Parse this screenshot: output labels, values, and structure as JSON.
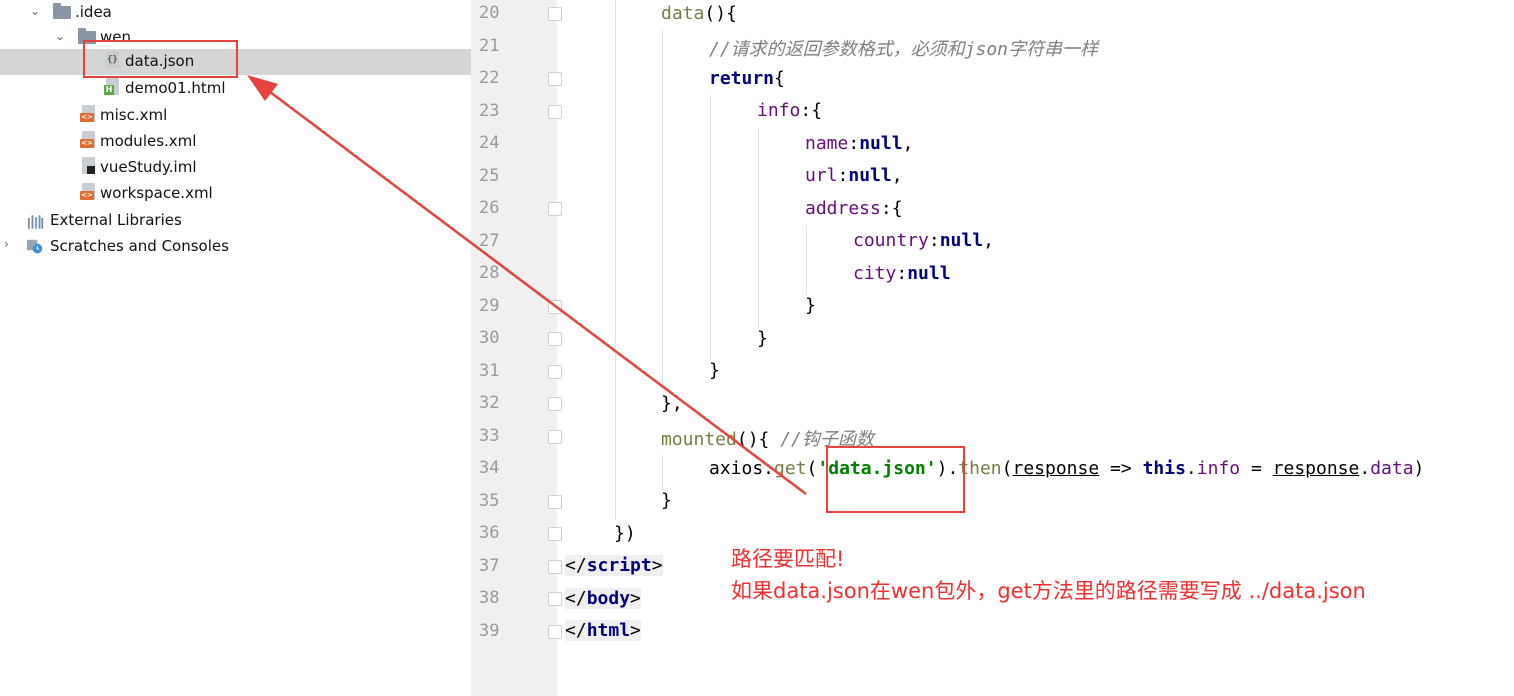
{
  "project_tree": {
    "items": [
      {
        "label": ".idea",
        "type": "folder",
        "expanded": true
      },
      {
        "label": "wen",
        "type": "folder",
        "expanded": true
      },
      {
        "label": "data.json",
        "type": "json",
        "selected": true
      },
      {
        "label": "demo01.html",
        "type": "html"
      },
      {
        "label": "misc.xml",
        "type": "xml"
      },
      {
        "label": "modules.xml",
        "type": "xml"
      },
      {
        "label": "vueStudy.iml",
        "type": "iml"
      },
      {
        "label": "workspace.xml",
        "type": "xml"
      },
      {
        "label": "External Libraries",
        "type": "libraries"
      },
      {
        "label": "Scratches and Consoles",
        "type": "scratches",
        "expanded": false
      }
    ]
  },
  "editor": {
    "line_numbers": [
      "20",
      "21",
      "22",
      "23",
      "24",
      "25",
      "26",
      "27",
      "28",
      "29",
      "30",
      "31",
      "32",
      "33",
      "34",
      "35",
      "36",
      "37",
      "38",
      "39"
    ],
    "lines": {
      "l20_fn": "data",
      "l20_rest": "(){",
      "l21_comment": "//请求的返回参数格式，必须和json字符串一样",
      "l22_kw": "return",
      "l22_rest": "{",
      "l23_prop": "info",
      "l23_rest": ":{",
      "l24_prop": "name",
      "l24_colon": ":",
      "l24_val": "null",
      "l24_rest": ",",
      "l25_prop": "url",
      "l25_colon": ":",
      "l25_val": "null",
      "l25_rest": ",",
      "l26_prop": "address",
      "l26_rest": ":{",
      "l27_prop": "country",
      "l27_colon": ":",
      "l27_val": "null",
      "l27_rest": ",",
      "l28_prop": "city",
      "l28_colon": ":",
      "l28_val": "null",
      "l29": "}",
      "l30": "}",
      "l31": "}",
      "l32": "},",
      "l33_fn": "mounted",
      "l33_rest": "(){ ",
      "l33_comment": "//钩子函数",
      "l34_obj": "axios.",
      "l34_get": "get",
      "l34_p1": "(",
      "l34_str": "'data.json'",
      "l34_p2": ").",
      "l34_then": "then",
      "l34_p3": "(",
      "l34_resp1": "response",
      "l34_arrow": " => ",
      "l34_this": "this",
      "l34_dot1": ".",
      "l34_info": "info",
      "l34_eq": " = ",
      "l34_resp2": "response",
      "l34_dot2": ".",
      "l34_data": "data",
      "l34_end": ")",
      "l35": "}",
      "l36": "})",
      "l37_open": "</",
      "l37_tag": "script",
      "l37_close": ">",
      "l38_open": "</",
      "l38_tag": "body",
      "l38_close": ">",
      "l39_open": "</",
      "l39_tag": "html",
      "l39_close": ">"
    }
  },
  "annotation": {
    "line1": "路径要匹配!",
    "line2": "如果data.json在wen包外，get方法里的路径需要写成  ../data.json",
    "color": "#f0312e"
  }
}
